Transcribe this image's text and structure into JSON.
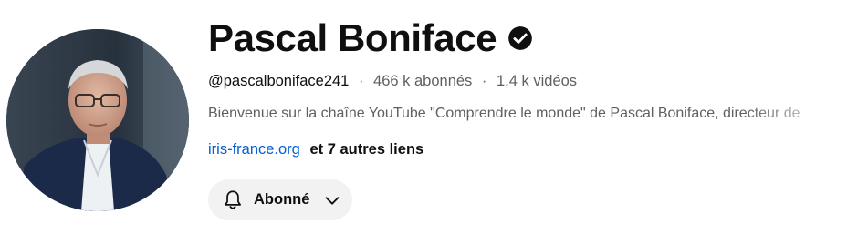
{
  "channel": {
    "name": "Pascal Boniface",
    "handle": "@pascalboniface241",
    "subscribers": "466 k abonnés",
    "videos": "1,4 k vidéos",
    "separator": "·",
    "description": "Bienvenue sur la chaîne YouTube \"Comprendre le monde\" de Pascal Boniface, directeur de",
    "link_text": "iris-france.org",
    "more_links": "et 7 autres liens",
    "subscribe_label": "Abonné"
  },
  "icons": {
    "verified": "verified-check-icon",
    "bell": "bell-icon",
    "chevron": "chevron-down-icon"
  },
  "colors": {
    "link": "#065fd4",
    "secondary_text": "#606060",
    "button_bg": "#f2f2f2"
  }
}
